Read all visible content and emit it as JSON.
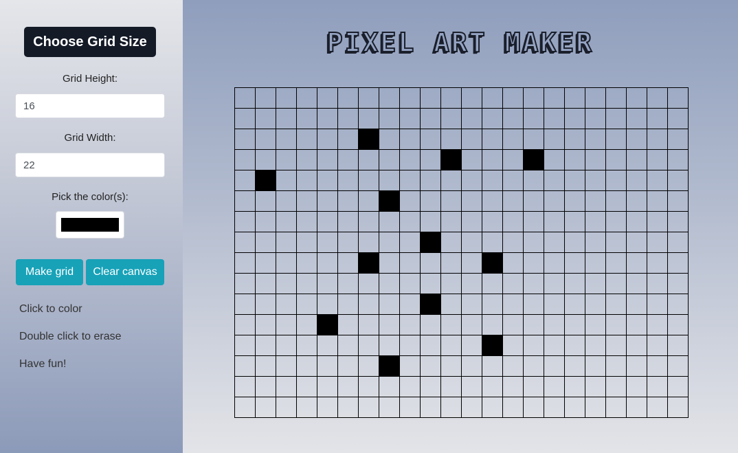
{
  "sidebar": {
    "choose_size_label": "Choose Grid Size",
    "height_label": "Grid Height:",
    "height_value": "16",
    "width_label": "Grid Width:",
    "width_value": "22",
    "color_label": "Pick the color(s):",
    "color_value": "#000000",
    "make_grid_label": "Make grid",
    "clear_canvas_label": "Clear canvas",
    "tips": [
      "Click to color",
      "Double click to erase",
      "Have fun!"
    ]
  },
  "main": {
    "title": "PIXEL ART MAKER"
  },
  "canvas": {
    "rows": 16,
    "cols": 22,
    "fill_color": "#000000",
    "filled_cells": [
      {
        "row": 2,
        "col": 6
      },
      {
        "row": 3,
        "col": 10
      },
      {
        "row": 3,
        "col": 14
      },
      {
        "row": 4,
        "col": 1
      },
      {
        "row": 5,
        "col": 7
      },
      {
        "row": 7,
        "col": 9
      },
      {
        "row": 8,
        "col": 6
      },
      {
        "row": 8,
        "col": 12
      },
      {
        "row": 10,
        "col": 9
      },
      {
        "row": 11,
        "col": 4
      },
      {
        "row": 12,
        "col": 12
      },
      {
        "row": 13,
        "col": 7
      }
    ]
  }
}
